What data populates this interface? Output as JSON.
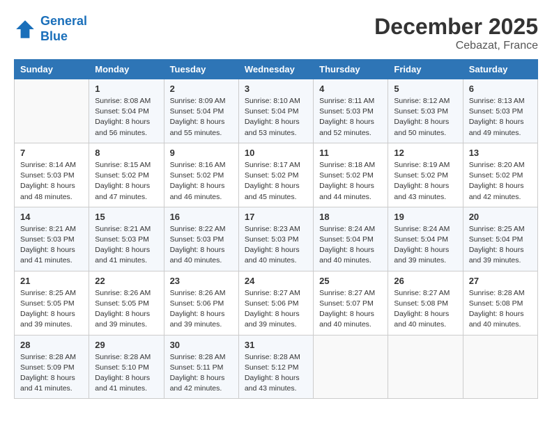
{
  "header": {
    "logo_line1": "General",
    "logo_line2": "Blue",
    "month_title": "December 2025",
    "location": "Cebazat, France"
  },
  "days_of_week": [
    "Sunday",
    "Monday",
    "Tuesday",
    "Wednesday",
    "Thursday",
    "Friday",
    "Saturday"
  ],
  "weeks": [
    [
      {
        "day": "",
        "info": ""
      },
      {
        "day": "1",
        "info": "Sunrise: 8:08 AM\nSunset: 5:04 PM\nDaylight: 8 hours\nand 56 minutes."
      },
      {
        "day": "2",
        "info": "Sunrise: 8:09 AM\nSunset: 5:04 PM\nDaylight: 8 hours\nand 55 minutes."
      },
      {
        "day": "3",
        "info": "Sunrise: 8:10 AM\nSunset: 5:04 PM\nDaylight: 8 hours\nand 53 minutes."
      },
      {
        "day": "4",
        "info": "Sunrise: 8:11 AM\nSunset: 5:03 PM\nDaylight: 8 hours\nand 52 minutes."
      },
      {
        "day": "5",
        "info": "Sunrise: 8:12 AM\nSunset: 5:03 PM\nDaylight: 8 hours\nand 50 minutes."
      },
      {
        "day": "6",
        "info": "Sunrise: 8:13 AM\nSunset: 5:03 PM\nDaylight: 8 hours\nand 49 minutes."
      }
    ],
    [
      {
        "day": "7",
        "info": "Sunrise: 8:14 AM\nSunset: 5:03 PM\nDaylight: 8 hours\nand 48 minutes."
      },
      {
        "day": "8",
        "info": "Sunrise: 8:15 AM\nSunset: 5:02 PM\nDaylight: 8 hours\nand 47 minutes."
      },
      {
        "day": "9",
        "info": "Sunrise: 8:16 AM\nSunset: 5:02 PM\nDaylight: 8 hours\nand 46 minutes."
      },
      {
        "day": "10",
        "info": "Sunrise: 8:17 AM\nSunset: 5:02 PM\nDaylight: 8 hours\nand 45 minutes."
      },
      {
        "day": "11",
        "info": "Sunrise: 8:18 AM\nSunset: 5:02 PM\nDaylight: 8 hours\nand 44 minutes."
      },
      {
        "day": "12",
        "info": "Sunrise: 8:19 AM\nSunset: 5:02 PM\nDaylight: 8 hours\nand 43 minutes."
      },
      {
        "day": "13",
        "info": "Sunrise: 8:20 AM\nSunset: 5:02 PM\nDaylight: 8 hours\nand 42 minutes."
      }
    ],
    [
      {
        "day": "14",
        "info": "Sunrise: 8:21 AM\nSunset: 5:03 PM\nDaylight: 8 hours\nand 41 minutes."
      },
      {
        "day": "15",
        "info": "Sunrise: 8:21 AM\nSunset: 5:03 PM\nDaylight: 8 hours\nand 41 minutes."
      },
      {
        "day": "16",
        "info": "Sunrise: 8:22 AM\nSunset: 5:03 PM\nDaylight: 8 hours\nand 40 minutes."
      },
      {
        "day": "17",
        "info": "Sunrise: 8:23 AM\nSunset: 5:03 PM\nDaylight: 8 hours\nand 40 minutes."
      },
      {
        "day": "18",
        "info": "Sunrise: 8:24 AM\nSunset: 5:04 PM\nDaylight: 8 hours\nand 40 minutes."
      },
      {
        "day": "19",
        "info": "Sunrise: 8:24 AM\nSunset: 5:04 PM\nDaylight: 8 hours\nand 39 minutes."
      },
      {
        "day": "20",
        "info": "Sunrise: 8:25 AM\nSunset: 5:04 PM\nDaylight: 8 hours\nand 39 minutes."
      }
    ],
    [
      {
        "day": "21",
        "info": "Sunrise: 8:25 AM\nSunset: 5:05 PM\nDaylight: 8 hours\nand 39 minutes."
      },
      {
        "day": "22",
        "info": "Sunrise: 8:26 AM\nSunset: 5:05 PM\nDaylight: 8 hours\nand 39 minutes."
      },
      {
        "day": "23",
        "info": "Sunrise: 8:26 AM\nSunset: 5:06 PM\nDaylight: 8 hours\nand 39 minutes."
      },
      {
        "day": "24",
        "info": "Sunrise: 8:27 AM\nSunset: 5:06 PM\nDaylight: 8 hours\nand 39 minutes."
      },
      {
        "day": "25",
        "info": "Sunrise: 8:27 AM\nSunset: 5:07 PM\nDaylight: 8 hours\nand 40 minutes."
      },
      {
        "day": "26",
        "info": "Sunrise: 8:27 AM\nSunset: 5:08 PM\nDaylight: 8 hours\nand 40 minutes."
      },
      {
        "day": "27",
        "info": "Sunrise: 8:28 AM\nSunset: 5:08 PM\nDaylight: 8 hours\nand 40 minutes."
      }
    ],
    [
      {
        "day": "28",
        "info": "Sunrise: 8:28 AM\nSunset: 5:09 PM\nDaylight: 8 hours\nand 41 minutes."
      },
      {
        "day": "29",
        "info": "Sunrise: 8:28 AM\nSunset: 5:10 PM\nDaylight: 8 hours\nand 41 minutes."
      },
      {
        "day": "30",
        "info": "Sunrise: 8:28 AM\nSunset: 5:11 PM\nDaylight: 8 hours\nand 42 minutes."
      },
      {
        "day": "31",
        "info": "Sunrise: 8:28 AM\nSunset: 5:12 PM\nDaylight: 8 hours\nand 43 minutes."
      },
      {
        "day": "",
        "info": ""
      },
      {
        "day": "",
        "info": ""
      },
      {
        "day": "",
        "info": ""
      }
    ]
  ]
}
